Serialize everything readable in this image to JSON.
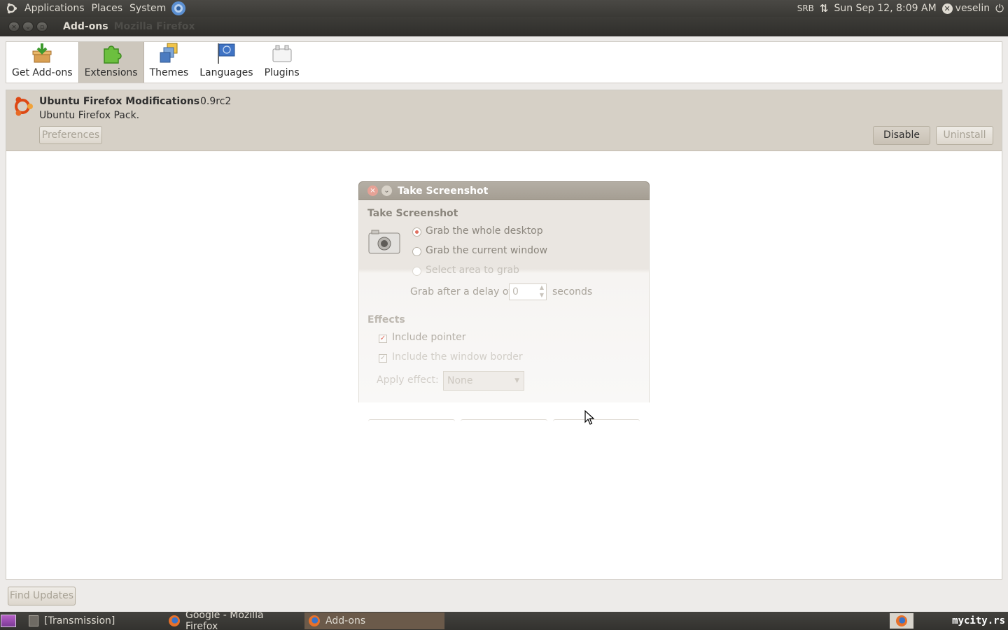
{
  "top_panel": {
    "menu": [
      "Applications",
      "Places",
      "System"
    ],
    "keyboard_layout": "SRB",
    "clock": "Sun Sep 12,  8:09 AM",
    "user": "veselin"
  },
  "window": {
    "title": "Add-ons",
    "app": "Mozilla Firefox"
  },
  "toolbar": {
    "tabs": [
      {
        "label": "Get Add-ons",
        "icon": "get-addons-icon"
      },
      {
        "label": "Extensions",
        "icon": "extensions-icon",
        "active": true
      },
      {
        "label": "Themes",
        "icon": "themes-icon"
      },
      {
        "label": "Languages",
        "icon": "languages-icon"
      },
      {
        "label": "Plugins",
        "icon": "plugins-icon"
      }
    ]
  },
  "addon": {
    "name": "Ubuntu Firefox Modifications",
    "version": "0.9rc2",
    "description": "Ubuntu Firefox Pack.",
    "preferences_label": "Preferences",
    "disable_label": "Disable",
    "uninstall_label": "Uninstall"
  },
  "dialog": {
    "title": "Take Screenshot",
    "heading": "Take Screenshot",
    "options": [
      "Grab the whole desktop",
      "Grab the current window",
      "Select area to grab"
    ],
    "delay_prefix": "Grab after a delay of",
    "delay_value": "0",
    "delay_suffix": "seconds",
    "effects_heading": "Effects",
    "include_pointer": "Include pointer",
    "include_border": "Include the window border",
    "apply_effect_label": "Apply effect:",
    "apply_effect_value": "None"
  },
  "footer": {
    "find_updates_label": "Find Updates"
  },
  "bottom_panel": {
    "tasks": [
      "[Transmission]",
      "Google - Mozilla Firefox",
      "Add-ons"
    ],
    "watermark": "mycity.rs"
  },
  "colors": {
    "panel": "#3a3935",
    "selected_row": "#d6d0c6",
    "accent": "#e07060"
  }
}
